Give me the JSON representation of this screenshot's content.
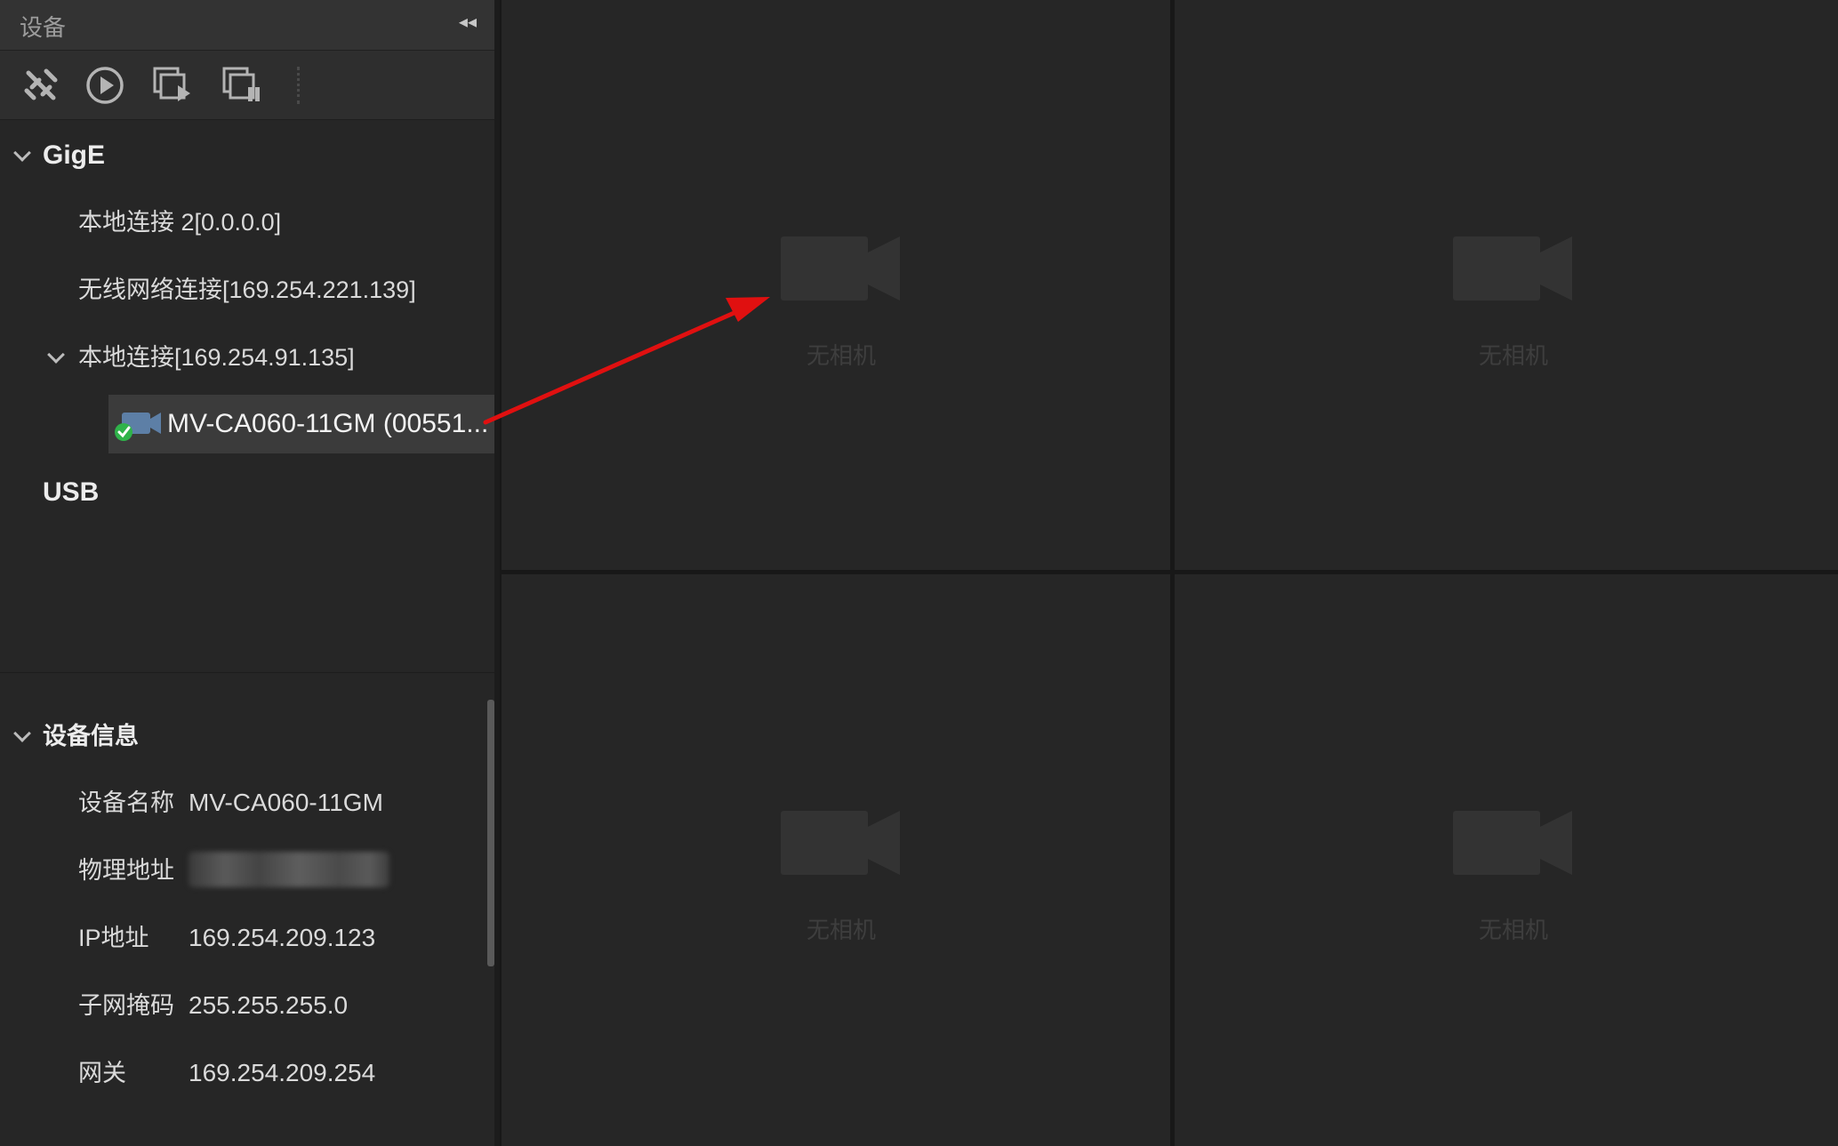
{
  "panel": {
    "title": "设备",
    "collapse_glyph": "◂◂"
  },
  "toolbar": {
    "icons": [
      "disconnect-icon",
      "play-icon",
      "start-grab-all-icon",
      "stop-grab-all-icon"
    ]
  },
  "tree": {
    "gige_label": "GigE",
    "networks": [
      {
        "label": "本地连接 2[0.0.0.0]"
      },
      {
        "label": "无线网络连接[169.254.221.139]"
      },
      {
        "label": "本地连接[169.254.91.135]"
      }
    ],
    "device": {
      "label": "MV-CA060-11GM (00551...",
      "status": "connected"
    },
    "usb_label": "USB"
  },
  "device_info": {
    "header": "设备信息",
    "rows": [
      {
        "key": "设备名称",
        "value": "MV-CA060-11GM"
      },
      {
        "key": "物理地址",
        "value": ""
      },
      {
        "key": "IP地址",
        "value": "169.254.209.123"
      },
      {
        "key": "子网掩码",
        "value": "255.255.255.0"
      },
      {
        "key": "网关",
        "value": "169.254.209.254"
      }
    ]
  },
  "preview": {
    "cells": [
      {
        "label": "无相机"
      },
      {
        "label": "无相机"
      },
      {
        "label": "无相机"
      },
      {
        "label": "无相机"
      }
    ]
  },
  "colors": {
    "panel_bg": "#262626",
    "selected_row": "#3b3b3b",
    "status_ok": "#2fb34a",
    "annotation_arrow": "#e01010",
    "camera_placeholder": "#333333"
  }
}
